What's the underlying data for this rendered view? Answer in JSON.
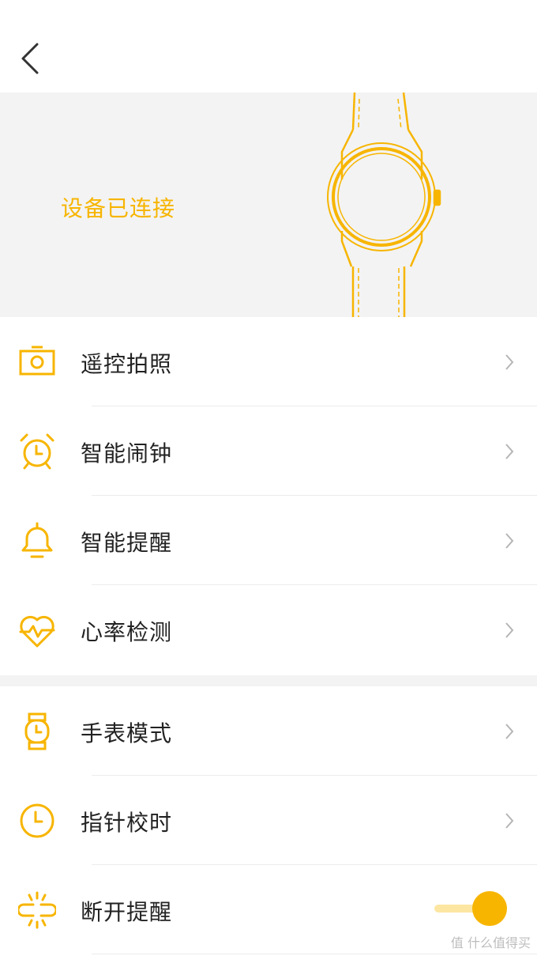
{
  "banner": {
    "status": "设备已连接"
  },
  "menu_group1": [
    {
      "label": "遥控拍照",
      "icon": "camera-icon"
    },
    {
      "label": "智能闹钟",
      "icon": "alarm-clock-icon"
    },
    {
      "label": "智能提醒",
      "icon": "bell-icon"
    },
    {
      "label": "心率检测",
      "icon": "heart-rate-icon"
    }
  ],
  "menu_group2": [
    {
      "label": "手表模式",
      "icon": "watch-icon"
    },
    {
      "label": "指针校时",
      "icon": "clock-icon"
    },
    {
      "label": "断开提醒",
      "icon": "disconnect-icon",
      "toggle_on": true
    }
  ],
  "watermark": "值 什么值得买",
  "colors": {
    "accent": "#f7b500",
    "accent_light": "#fce6a2",
    "banner_bg": "#f3f3f3"
  }
}
